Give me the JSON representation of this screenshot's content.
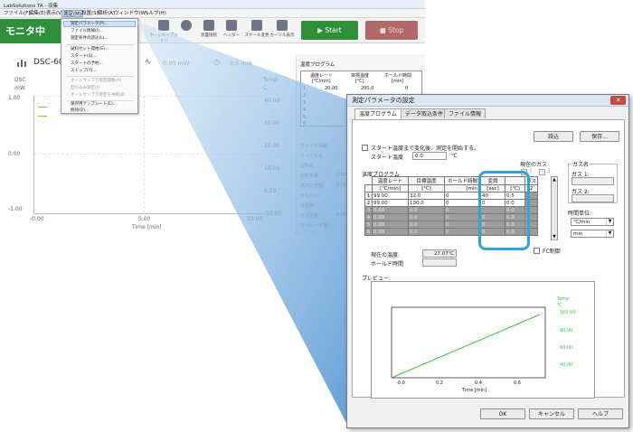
{
  "main_window": {
    "title": "LabSolutions TA - 収集",
    "menu": [
      "ファイル(F)",
      "編集(E)",
      "表示(V)",
      "測定(M)",
      "設置(S)",
      "解析(A)",
      "ウィンドウ(W)",
      "ヘルプ(H)"
    ],
    "mode_label": "モニタ中",
    "toolbar": [
      {
        "label": "ホームキャプション",
        "icon": "home-icon"
      },
      {
        "label": "",
        "icon": "gear-icon"
      },
      {
        "label": "装置接続",
        "icon": "connect-icon"
      },
      {
        "label": "ヘッダー",
        "icon": "header-icon"
      },
      {
        "label": "スケール変更",
        "icon": "scale-icon"
      },
      {
        "label": "カーソル表示",
        "icon": "cursor-icon"
      }
    ],
    "start_label": "Start",
    "stop_label": "Stop",
    "instrument": "DSC-60",
    "power_reading": "0.00 mW",
    "time_reading": "0.0 min",
    "graph": {
      "ylabel_top": "DSC",
      "yunit": "mW",
      "yticks": [
        "1.00",
        "0.00",
        "-1.00"
      ],
      "xticks": [
        "-0.00",
        "5.00",
        "10.00"
      ],
      "xlabel": "Time [min]",
      "temp_label": "Temp",
      "temp_unit": "C",
      "temp_ticks": [
        "40.00",
        "30.00",
        "20.00",
        "10.00",
        "0.00",
        "-10.00"
      ]
    },
    "side_panel": {
      "title": "温度プログラム",
      "headers": [
        "温度レート",
        "目標温度",
        "ホールド時間"
      ],
      "units": [
        "[℃/min]",
        "[℃]",
        "[min]"
      ],
      "first_row": [
        "20.00",
        "200.0",
        "0"
      ],
      "row_numbers": [
        "1",
        "2",
        "3",
        "4",
        "5",
        "6"
      ],
      "info_labels": [
        "ファイル情報",
        "サンプル名",
        "試料名:",
        "試料質量:",
        "試料の容器:",
        "セル/パン:",
        "雰囲気:",
        "ガス流量:",
        "オペレータ名:"
      ],
      "info_values": [
        "",
        "",
        "",
        "0.00",
        "0.00",
        "",
        "",
        "0.00",
        ""
      ]
    }
  },
  "dropdown_menu": {
    "items": [
      "測定パラメータ(P)...",
      "ファイル情報(I)...",
      "測定条件の読込(L)...",
      "試料セット開始(S)...",
      "スタート(S)...",
      "スタートの予約...",
      "ストップ(T)...",
      "オートサンプラ測定開始(A)",
      "割り込み測定(I)",
      "オートサンプラ測定を中断(B)",
      "保存用テンプレート(E)...",
      "削除(D)..."
    ],
    "disabled": [
      false,
      false,
      false,
      false,
      false,
      false,
      false,
      true,
      true,
      true,
      false,
      false
    ]
  },
  "dialog": {
    "title": "測定パラメータの設定",
    "close_label": "✕",
    "tabs": [
      "温度プログラム",
      "データ取込条件",
      "ファイル情報"
    ],
    "read_label": "読込",
    "save_label": "保存...",
    "start_temp_check_label": "スタート温度まで変化後、測定を開始する。",
    "start_temp_label": "スタート温度",
    "start_temp_value": "0.0",
    "start_temp_unit": "℃",
    "current_gas_label": "現在のガス",
    "gas_options": [
      "1",
      "2"
    ],
    "gas_name_label": "ガス名",
    "gas1_label": "ガス 1:",
    "gas2_label": "ガス 2:",
    "program_title": "温度プログラム",
    "table_headers": [
      "温度レート",
      "目標温度",
      "ホールド時間",
      "変調",
      "",
      "ガス"
    ],
    "table_units": [
      "[℃/min]",
      "[℃]",
      "[min]",
      "[sec]",
      "[℃]",
      "2"
    ],
    "rows": [
      {
        "n": "1",
        "cells": [
          "99.00",
          "32.0",
          "0",
          "40",
          "0.5",
          ""
        ]
      },
      {
        "n": "2",
        "cells": [
          "99.00",
          "130.0",
          "0",
          "0",
          "0.0",
          ""
        ]
      },
      {
        "n": "3",
        "cells": [
          "0.00",
          "0.0",
          "0",
          "",
          "0.0",
          ""
        ]
      },
      {
        "n": "4",
        "cells": [
          "0.00",
          "0.0",
          "0",
          "0",
          "0.0",
          ""
        ]
      },
      {
        "n": "5",
        "cells": [
          "0.00",
          "0.0",
          "0",
          "0",
          "0.0",
          ""
        ]
      },
      {
        "n": "6",
        "cells": [
          "0.00",
          "0.0",
          "0",
          "0",
          "0.0",
          ""
        ]
      }
    ],
    "time_unit_label": "時間単位:",
    "time_unit_options": [
      "℃/min",
      "min"
    ],
    "fc_label": "FC制御",
    "current_temp_label": "現在の温度:",
    "current_temp_value": "27.07℃",
    "hold_time_label": "ホールド時間",
    "preview_label": "プレビュー:",
    "preview": {
      "temp_label": "Temp",
      "temp_unit": "℃",
      "temp_ticks": [
        "100.00",
        "80.00",
        "60.00",
        "40.00"
      ],
      "xticks": [
        "-0.0",
        "0.2",
        "0.4",
        "0.6"
      ],
      "xlabel": "Time [min]"
    },
    "ok_label": "OK",
    "cancel_label": "キャンセル",
    "help_label": "ヘルプ"
  }
}
